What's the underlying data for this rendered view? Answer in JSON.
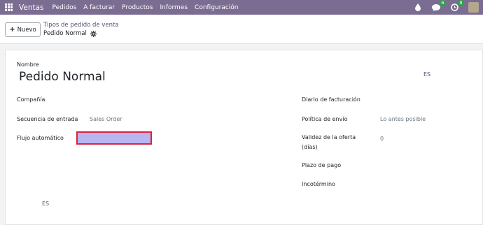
{
  "navbar": {
    "app_name": "Ventas",
    "menu": [
      "Pedidos",
      "A facturar",
      "Productos",
      "Informes",
      "Configuración"
    ],
    "messages_count": "6",
    "activities_count": "8",
    "colors": {
      "bg": "#7b6d92",
      "badge": "#28a745"
    }
  },
  "control": {
    "new_button": "Nuevo",
    "breadcrumb_parent": "Tipos de pedido de venta",
    "record_name": "Pedido Normal"
  },
  "form": {
    "name_label": "Nombre",
    "name_value": "Pedido Normal",
    "name_lang": "ES",
    "left_fields": {
      "company_label": "Compañía",
      "company_value": "",
      "sequence_label": "Secuencia de entrada",
      "sequence_value": "Sales Order",
      "flow_label": "Flujo automático",
      "flow_value": ""
    },
    "right_fields": {
      "journal_label": "Diario de facturación",
      "journal_value": "",
      "shipping_label": "Política de envío",
      "shipping_value": "Lo antes posible",
      "validity_label_line1": "Validez de la oferta",
      "validity_label_line2": "(días)",
      "validity_value": "0",
      "payment_label": "Plazo de pago",
      "incoterm_label": "Incotérmino"
    },
    "bottom_lang": "ES"
  }
}
